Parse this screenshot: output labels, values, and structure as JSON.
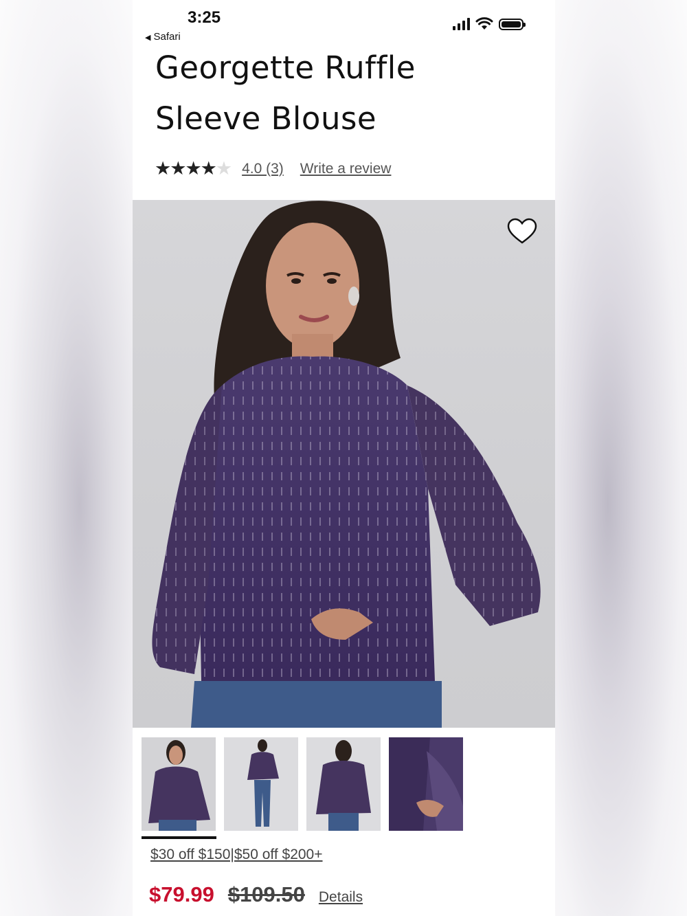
{
  "status_bar": {
    "time": "3:25",
    "back_app": "Safari"
  },
  "product": {
    "title_line1": "Georgette Ruffle",
    "title_line2": "Sleeve Blouse",
    "rating": 4.0,
    "rating_text": "4.0 (3)",
    "write_review": "Write a review",
    "promo": "$30 off $150|$50 off $200+",
    "sale_price": "$79.99",
    "original_price": "$109.50",
    "details_link": "Details"
  },
  "gallery": {
    "thumbnails": [
      "front-view",
      "full-length-view",
      "back-view",
      "sleeve-detail-view"
    ],
    "selected_index": 0
  },
  "colors": {
    "sale_red": "#c8102e",
    "blouse_purple": "#3b2a5c",
    "text_dark": "#111111"
  },
  "icons": [
    "heart-icon",
    "signal-icon",
    "wifi-icon",
    "battery-icon",
    "back-triangle-icon",
    "star-icon"
  ]
}
